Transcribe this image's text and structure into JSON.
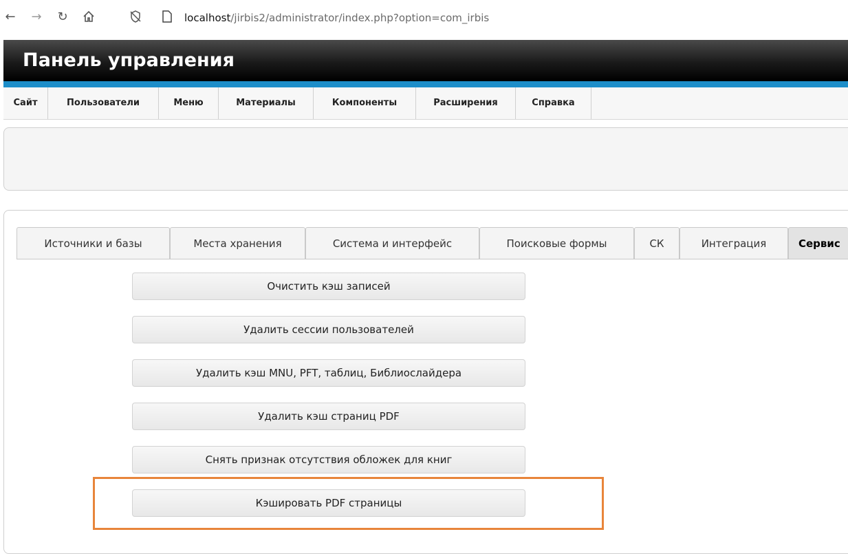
{
  "browser": {
    "url_host": "localhost",
    "url_path": "/jirbis2/administrator/index.php?option=com_irbis"
  },
  "header": {
    "title": "Панель управления"
  },
  "top_menu": [
    {
      "label": "Сайт"
    },
    {
      "label": "Пользователи"
    },
    {
      "label": "Меню"
    },
    {
      "label": "Материалы"
    },
    {
      "label": "Компоненты"
    },
    {
      "label": "Расширения"
    },
    {
      "label": "Справка"
    }
  ],
  "tabs": [
    {
      "label": "Источники и базы"
    },
    {
      "label": "Места хранения"
    },
    {
      "label": "Система и интерфейс"
    },
    {
      "label": "Поисковые формы"
    },
    {
      "label": "СК"
    },
    {
      "label": "Интеграция"
    },
    {
      "label": "Сервис",
      "active": true
    }
  ],
  "service_buttons": [
    {
      "label": "Очистить кэш записей"
    },
    {
      "label": "Удалить сессии пользователей"
    },
    {
      "label": "Удалить кэш MNU, PFT, таблиц, Библиослайдера"
    },
    {
      "label": "Удалить кэш страниц PDF"
    },
    {
      "label": "Снять признак отсутствия обложек для книг"
    },
    {
      "label": "Кэшировать PDF страницы"
    }
  ],
  "colors": {
    "accent_stripe": "#1d8ec9",
    "highlight": "#e8853a"
  }
}
